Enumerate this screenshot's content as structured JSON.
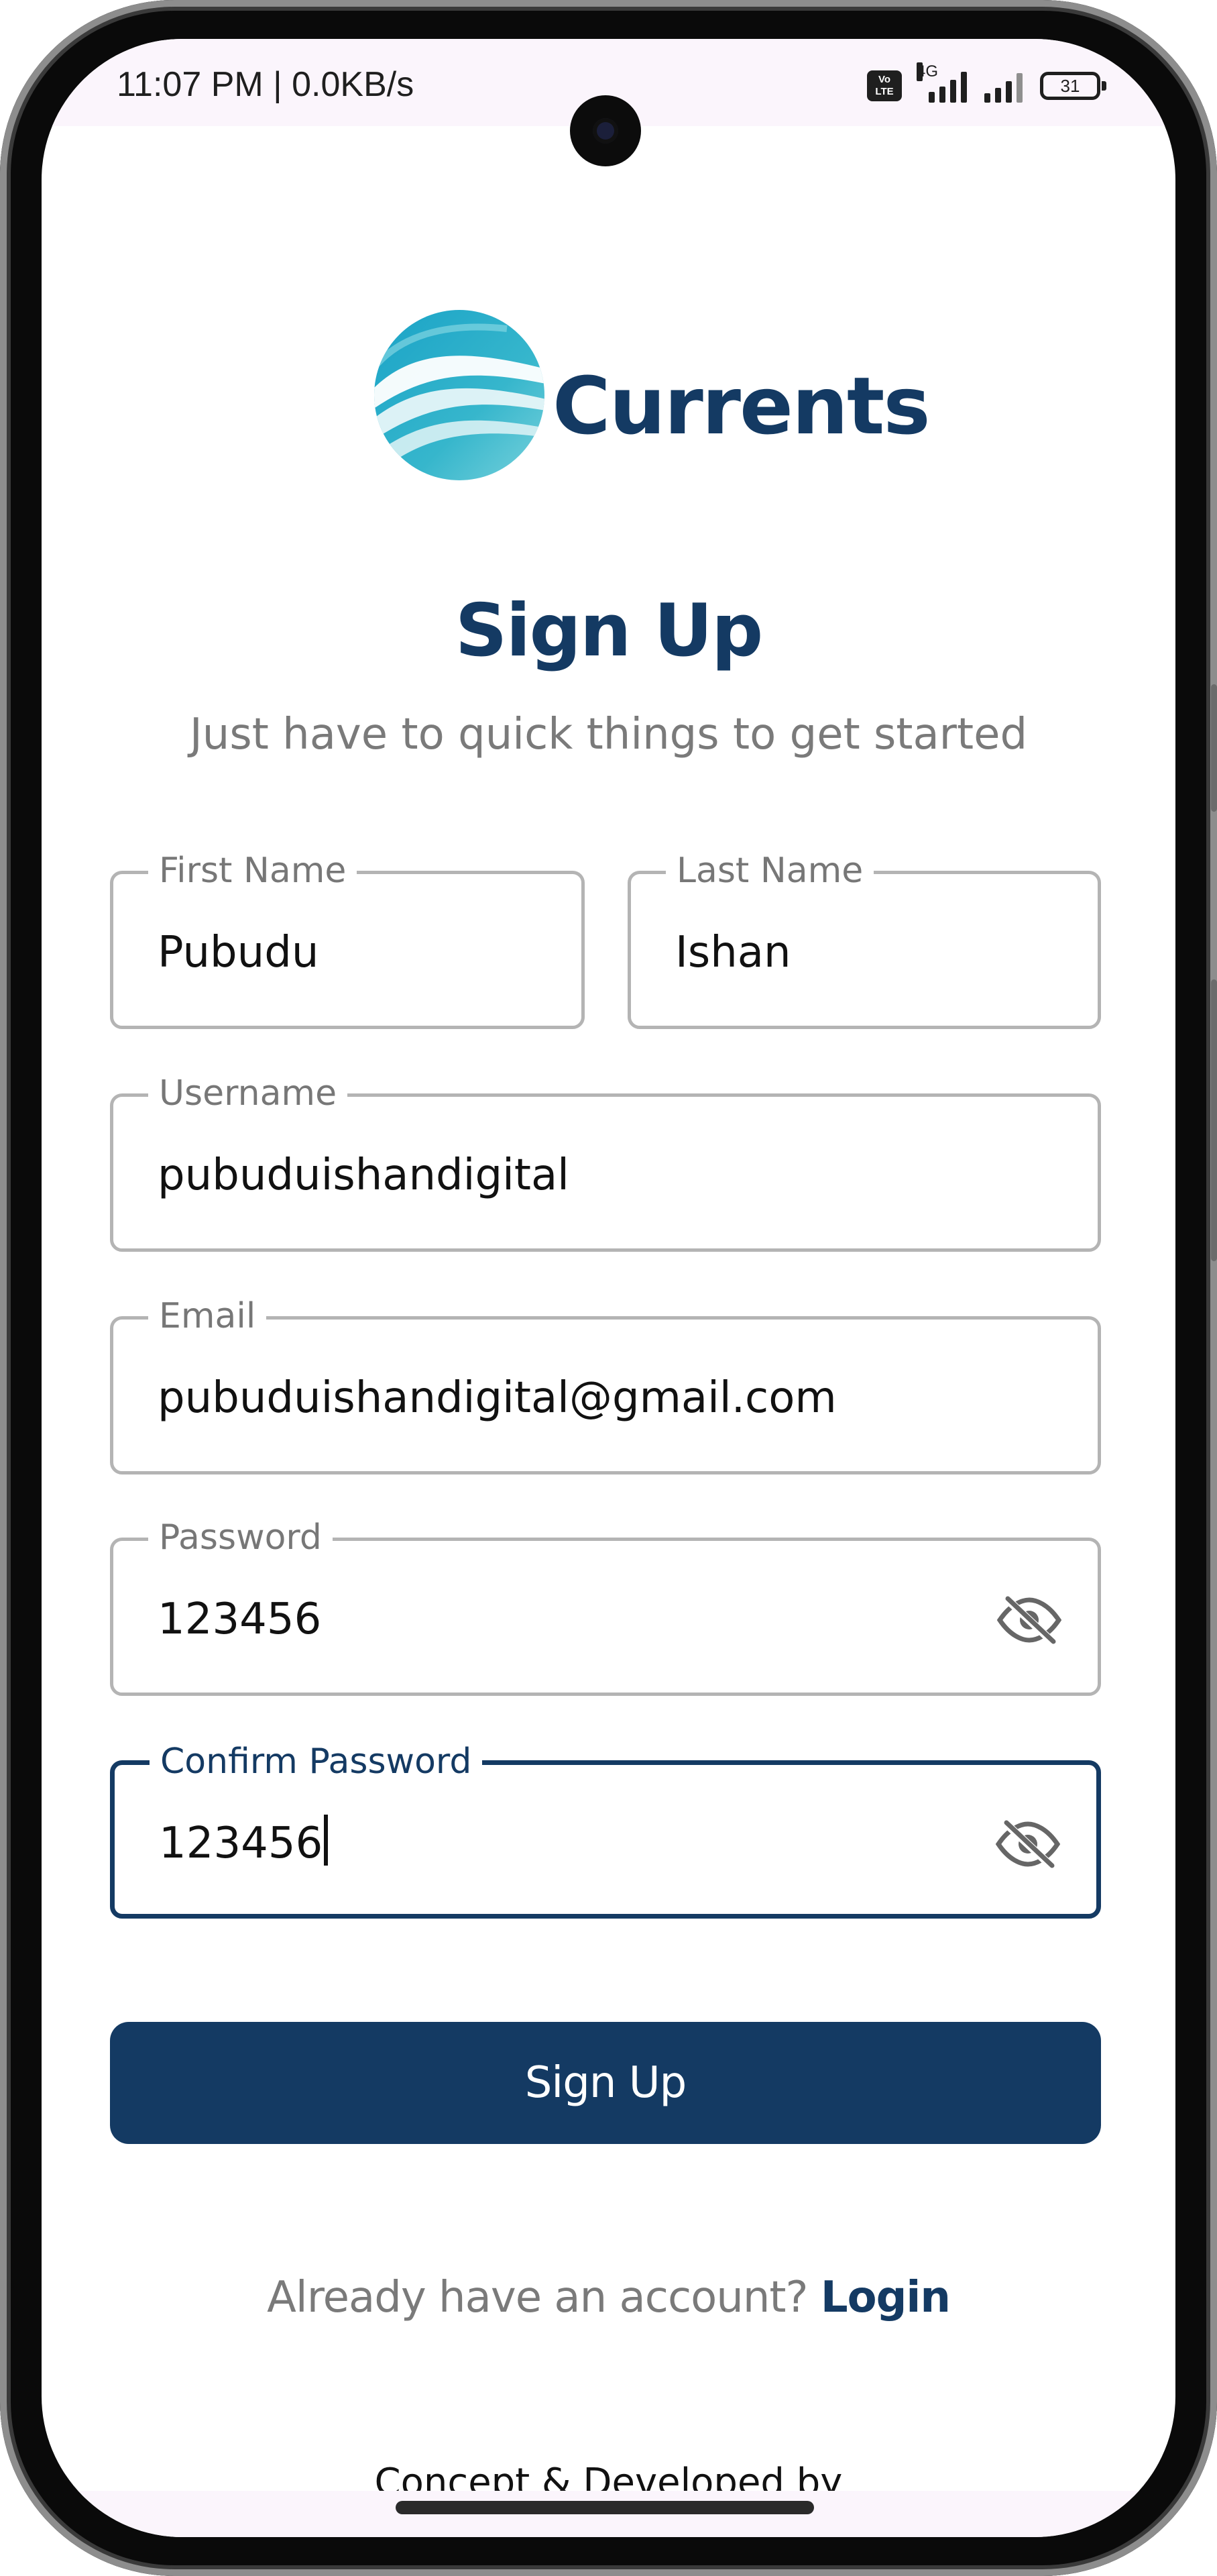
{
  "status_bar": {
    "time_speed": "11:07 PM | 0.0KB/s",
    "volte_line1": "Vo",
    "volte_line2": "LTE",
    "network": "4G",
    "battery": "31"
  },
  "brand": {
    "name": "Currents",
    "logo_colors": [
      "#2a9fc4",
      "#5cc6d6",
      "#e8f6f8"
    ]
  },
  "page": {
    "title": "Sign Up",
    "subtitle": "Just have to quick things to get started"
  },
  "form": {
    "first_name": {
      "label": "First Name",
      "value": "Pubudu"
    },
    "last_name": {
      "label": "Last Name",
      "value": "Ishan"
    },
    "username": {
      "label": "Username",
      "value": "pubuduishandigital"
    },
    "email": {
      "label": "Email",
      "value": "pubuduishandigital@gmail.com"
    },
    "password": {
      "label": "Password",
      "value": "123456",
      "toggle_icon": "eye-off-icon"
    },
    "confirm_password": {
      "label": "Confirm Password",
      "value": "123456",
      "toggle_icon": "eye-off-icon",
      "focused": true
    }
  },
  "actions": {
    "signup_label": "Sign Up",
    "login_prompt": "Already have an account?",
    "login_link": "Login"
  },
  "footer": {
    "credit": "Concept & Developed by"
  },
  "colors": {
    "primary": "#143a63",
    "muted_text": "#7a7a7a",
    "field_border": "#b4b4b4"
  }
}
